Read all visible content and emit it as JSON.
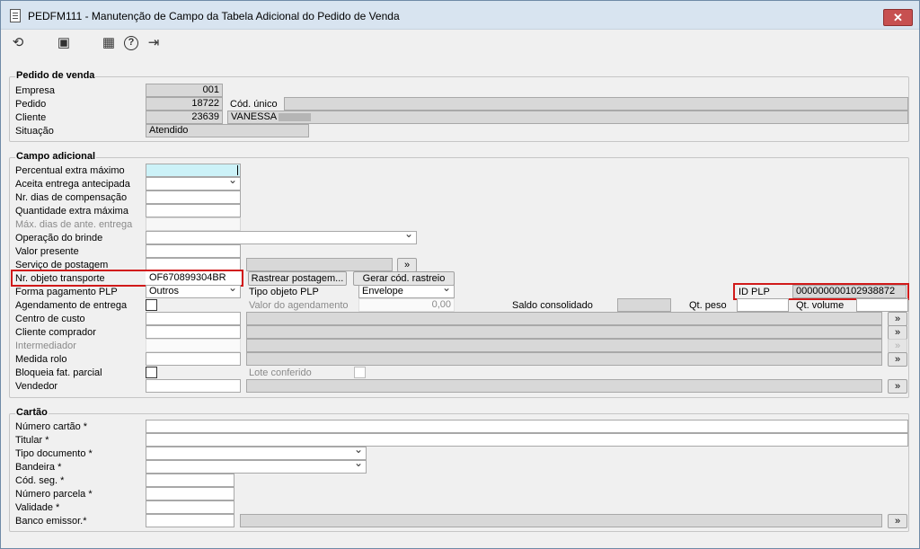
{
  "window": {
    "title": "PEDFM111 - Manutenção de Campo da Tabela Adicional do Pedido de Venda",
    "close": "✕"
  },
  "toolbar": {
    "refresh": "⟲",
    "save": "▣",
    "calendar": "▦",
    "help": "?",
    "exit": "⇥"
  },
  "pedido": {
    "title": "Pedido de venda",
    "empresa_label": "Empresa",
    "empresa": "001",
    "pedido_label": "Pedido",
    "pedido": "18722",
    "cod_unico_label": "Cód. único",
    "cod_unico": "",
    "cliente_label": "Cliente",
    "cliente_code": "23639",
    "cliente_name": "VANESSA",
    "situacao_label": "Situação",
    "situacao": "Atendido"
  },
  "campo": {
    "title": "Campo adicional",
    "percentual_label": "Percentual extra máximo",
    "percentual": "",
    "aceita_label": "Aceita entrega antecipada",
    "aceita": "",
    "nr_dias_label": "Nr. dias de compensação",
    "nr_dias": "",
    "quantidade_label": "Quantidade extra máxima",
    "quantidade": "",
    "max_dias_label": "Máx. dias de ante. entrega",
    "max_dias": "",
    "operacao_label": "Operação do brinde",
    "operacao": "",
    "valor_presente_label": "Valor presente",
    "valor_presente": "",
    "servico_label": "Serviço de postagem",
    "servico_code": "",
    "servico_desc": "",
    "nr_objeto_label": "Nr. objeto transporte",
    "nr_objeto": "OF670899304BR",
    "rastrear_btn": "Rastrear postagem...",
    "gerar_btn": "Gerar cód. rastreio",
    "id_plp_label": "ID PLP",
    "id_plp": "000000000102938872",
    "forma_pag_label": "Forma pagamento PLP",
    "forma_pag": "Outros",
    "tipo_obj_label": "Tipo objeto PLP",
    "tipo_obj": "Envelope",
    "agendamento_label": "Agendamento de entrega",
    "valor_agend_label": "Valor do agendamento",
    "valor_agend": "0,00",
    "saldo_label": "Saldo consolidado",
    "saldo": "",
    "qt_peso_label": "Qt. peso",
    "qt_peso": "",
    "qt_volume_label": "Qt. volume",
    "qt_volume": "",
    "centro_label": "Centro de custo",
    "centro": "",
    "cliente_comp_label": "Cliente comprador",
    "cliente_comp": "",
    "intermediador_label": "Intermediador",
    "intermediador": "",
    "medida_label": "Medida rolo",
    "medida": "",
    "bloqueia_label": "Bloqueia fat. parcial",
    "lote_label": "Lote conferido",
    "vendedor_label": "Vendedor",
    "vendedor": ""
  },
  "cartao": {
    "title": "Cartão",
    "numero_label": "Número cartão *",
    "numero": "",
    "titular_label": "Titular *",
    "titular": "",
    "tipo_doc_label": "Tipo documento *",
    "tipo_doc": "",
    "bandeira_label": "Bandeira *",
    "bandeira": "",
    "cod_seg_label": "Cód. seg. *",
    "cod_seg": "",
    "parcela_label": "Número parcela *",
    "parcela": "",
    "validade_label": "Validade *",
    "validade": "",
    "banco_label": "Banco emissor.*",
    "banco": ""
  },
  "lookup_label": "»",
  "colors": {
    "titlebar": "#d8e4f0",
    "highlight": "#d11a1a",
    "focus_field": "#ccf2f8"
  }
}
